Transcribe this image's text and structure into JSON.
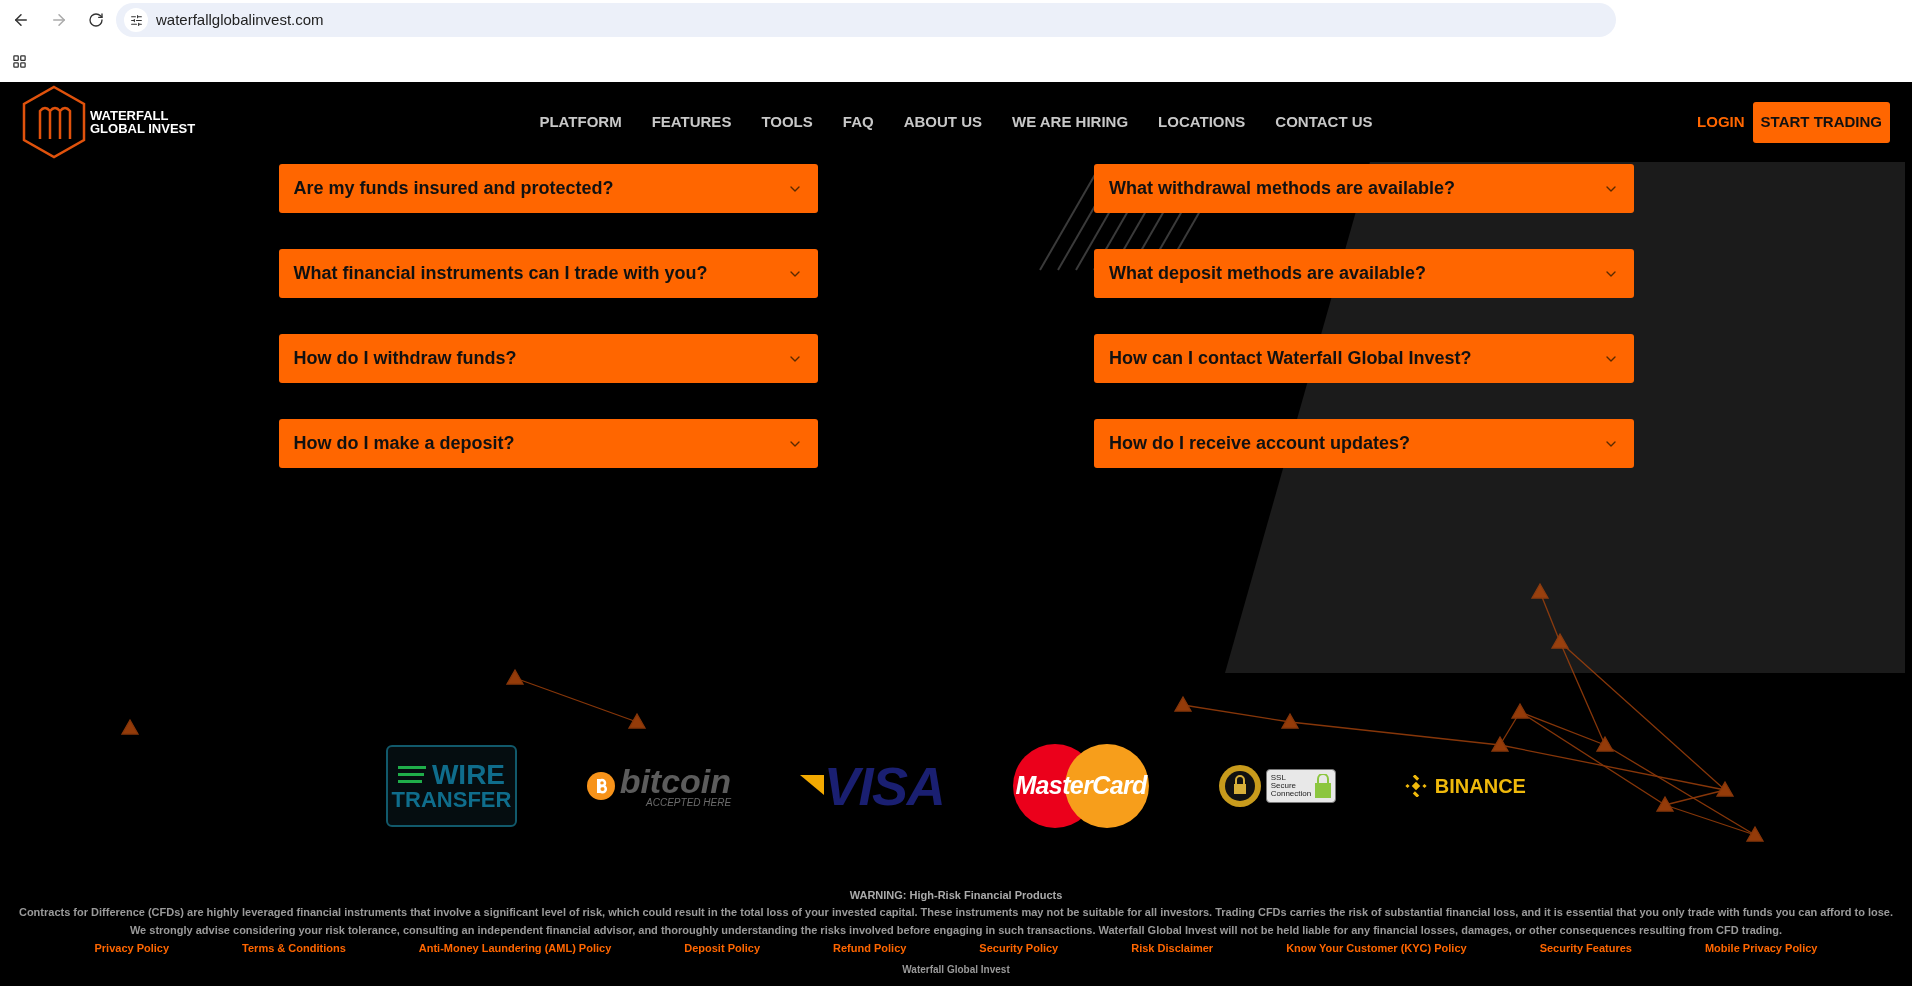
{
  "browser": {
    "url": "waterfallglobalinvest.com"
  },
  "site": {
    "logo_lines": [
      "WATERFALL",
      "GLOBAL INVEST"
    ],
    "nav": [
      "PLATFORM",
      "FEATURES",
      "TOOLS",
      "FAQ",
      "ABOUT US",
      "WE ARE HIRING",
      "LOCATIONS",
      "CONTACT US"
    ],
    "login": "LOGIN",
    "cta": "START TRADING"
  },
  "faq": {
    "left": [
      {
        "question": "Are my funds insured and protected?",
        "expanded": false
      },
      {
        "question": "What financial instruments can I trade with you?",
        "expanded": false
      },
      {
        "question": "How do I withdraw funds?",
        "expanded": false
      },
      {
        "question": "How do I make a deposit?",
        "expanded": false
      }
    ],
    "right": [
      {
        "question": "What withdrawal methods are available?",
        "expanded": false
      },
      {
        "question": "What deposit methods are available?",
        "expanded": false
      },
      {
        "question": "How can I contact Waterfall Global Invest?",
        "expanded": false
      },
      {
        "question": "How do I receive account updates?",
        "expanded": false
      }
    ]
  },
  "payment_logos": [
    {
      "kind": "wire",
      "lines": [
        "WIRE",
        "TRANSFER"
      ]
    },
    {
      "kind": "bitcoin",
      "name": "bitcoin",
      "tagline": "ACCEPTED HERE"
    },
    {
      "kind": "visa",
      "name": "VISA"
    },
    {
      "kind": "mastercard",
      "name": "MasterCard"
    },
    {
      "kind": "ssl",
      "lines": [
        "SSL",
        "Secure",
        "Connection"
      ]
    },
    {
      "kind": "binance",
      "name": "BINANCE"
    }
  ],
  "footer": {
    "warning_title": "WARNING: High-Risk Financial Products",
    "warning_text": "Contracts for Difference (CFDs) are highly leveraged financial instruments that involve a significant level of risk, which could result in the total loss of your invested capital. These instruments may not be suitable for all investors. Trading CFDs carries the risk of substantial financial loss, and it is essential that you only trade with funds you can afford to lose. We strongly advise considering your risk tolerance, consulting an independent financial advisor, and thoroughly understanding the risks involved before engaging in such transactions. Waterfall Global Invest will not be held liable for any financial losses, damages, or other consequences resulting from CFD trading.",
    "links": [
      "Privacy Policy",
      "Terms & Conditions",
      "Anti-Money Laundering (AML) Policy",
      "Deposit Policy",
      "Refund Policy",
      "Security Policy",
      "Risk Disclaimer",
      "Know Your Customer (KYC) Policy",
      "Security Features",
      "Mobile Privacy Policy"
    ],
    "company": "Waterfall Global Invest"
  }
}
